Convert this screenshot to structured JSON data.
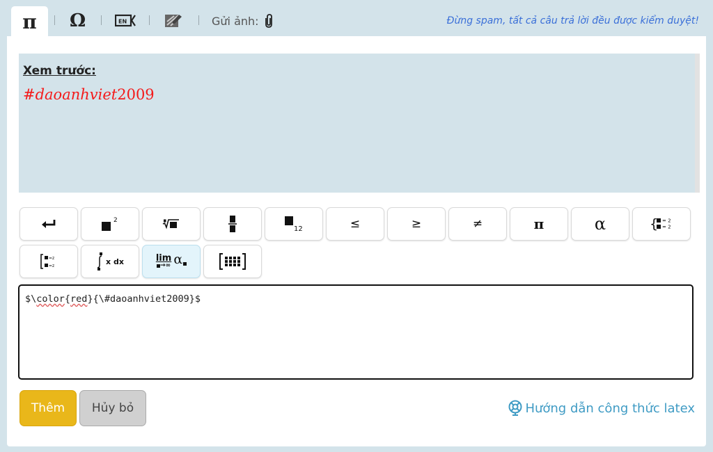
{
  "tabs": {
    "pi_label": "π",
    "omega_label": "Ω",
    "send_image_label": "Gửi ảnh:",
    "notice": "Đừng spam, tất cả câu trả lời đều được kiểm duyệt!"
  },
  "preview": {
    "label": "Xem trước:",
    "math_text": "#daoanhviet",
    "math_number": "2009",
    "math_color": "#f41a1a"
  },
  "toolbar": {
    "le": "≤",
    "ge": "≥",
    "ne": "≠",
    "pi": "π",
    "alpha": "α",
    "integral_suffix": "x dx",
    "lim_word": "lim",
    "lim_sub": "→∞",
    "lim_alpha": "α"
  },
  "editor": {
    "p1": "$\\",
    "p2": "color",
    "p3": "{",
    "p4": "red",
    "p5": "}{\\#daoanhviet2009}$"
  },
  "actions": {
    "add_label": "Thêm",
    "cancel_label": "Hủy bỏ",
    "guide_label": "Hướng dẫn công thức latex"
  },
  "colors": {
    "accent_button": "#e9b71a",
    "link": "#3f9bc4",
    "notice": "#3a6fd8"
  }
}
